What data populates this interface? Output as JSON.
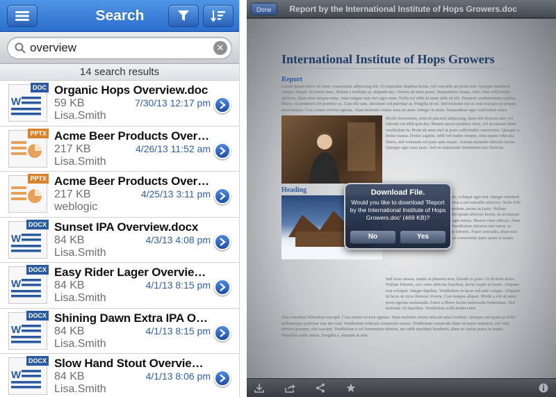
{
  "left": {
    "nav": {
      "title": "Search",
      "menu_icon": "hamburger-icon",
      "filter_icon": "funnel-icon",
      "sort_icon": "sort-icon"
    },
    "search": {
      "value": "overview",
      "placeholder": ""
    },
    "results_count": "14 search results",
    "results": [
      {
        "name": "Organic Hops Overview.doc",
        "size": "59 KB",
        "owner": "Lisa.Smith",
        "date": "7/30/13 12:17 pm",
        "type": "DOC",
        "kind": "word"
      },
      {
        "name": "Acme Beer Products Overvi...",
        "size": "217 KB",
        "owner": "Lisa.Smith",
        "date": "4/26/13 11:52 am",
        "type": "PPTX",
        "kind": "ppt"
      },
      {
        "name": "Acme Beer Products Overvi...",
        "size": "217 KB",
        "owner": "weblogic",
        "date": "4/25/13 3:11 pm",
        "type": "PPTX",
        "kind": "ppt"
      },
      {
        "name": "Sunset IPA Overview.docx",
        "size": "84 KB",
        "owner": "Lisa.Smith",
        "date": "4/3/13 4:08 pm",
        "type": "DOCX",
        "kind": "word"
      },
      {
        "name": "Easy Rider Lager Overview....",
        "size": "84 KB",
        "owner": "Lisa.Smith",
        "date": "4/1/13 8:15 pm",
        "type": "DOCX",
        "kind": "word"
      },
      {
        "name": "Shining Dawn Extra IPA Ove...",
        "size": "84 KB",
        "owner": "Lisa.Smith",
        "date": "4/1/13 8:15 pm",
        "type": "DOCX",
        "kind": "word"
      },
      {
        "name": "Slow Hand Stout Overview.d...",
        "size": "84 KB",
        "owner": "Lisa.Smith",
        "date": "4/1/13 8:06 pm",
        "type": "DOCX",
        "kind": "word"
      }
    ]
  },
  "right": {
    "done_label": "Done",
    "title": "Report by the International Institute of Hops Growers.doc",
    "doc": {
      "heading": "International Institute of Hops Growers",
      "section1": "Report",
      "para1": "Lorem ipsum dolor sit amet, consectetur adipiscing elit. Ut imperdiet dapibus lectus, vel convallis mi porta non. Quisque hendrerit semper aliquet. In lorem nunc, dictum a tristique at, aliquam nec, viverra sit amet purus. Suspendisse ornare, felis vitae sollicitudin ultricies, diam urna tempus urna, vitae congue sem orci eget enim. Nulla vel nibh sit amet nibh sit elit. Praesent condimentum sodales libero, eu hendrerit elit porttitor ac. Cras elit ante, tincidunt sed pulvinar at, fringilla id est. Sed molestie dui ac erat suscipit eu tempus urna tempus. Cras ornare viverra egestas. Nam molestie ornare urna sit amet. Integer in enim. Suspendisse eget vestibulum enim.",
      "para2": "Morbi fermentum, urna id placerat adipiscing, diam elit rhoncus nisi, vel lobortis est nibh quis dui. Mauris auctor porttitor risus, vel accumsan diam vestibulum in. Proin sit amet nisl ut justo sollicitudin consectetur. Quisque a lectus massa. Donec sagittis, nibh vel mattis semper, risus quam vehicula libero, sed venenatis est justo quis neque. Aenean molestie ultricies lectus. Quisque eget urna justo. Sed eu malesuada fermentum nec rhoncus.",
      "section2": "Heading",
      "para3": "Morbi lorem urna, dictum at auctor quis, volutpat eget erat. Integer euismod mi et erat luctus congue. Nulla eget lectus a est convallis ultricies. Nulla felis quam, luctus nec blandit in, aliquet interdum, metus in justo. Nullam tristique, ante nec malesuada lacinia, elit ipsum ultricies lectus, in accumsan nisi eget, vehicula tempor nec, auctor eget metus. Mauris vitae ultrices. Nam placerat condimentum nisi vitae sem. Vestibulum ultricies nisi tortor, ac rutrum turpis dictum. Quisque faucibus lobortis. Fusce convallis, diam non suscipit, magna lectus imperdiet eros, ut consectetur justo quam et turpis.",
      "para4": "Sed lacus massa, mattis at pharetra non, blandit in justo. Ut id diam dolor. Nullam lobortis, orci vitae ultricies faucibus, lectus turpis ut turpis. Aliquam erat volutpat. Integer dapibus. Vestibulum in lacus sed ante congue. Aliquam in lacus ut circa rhoncus viverra. Cras tempus aliquet. Morbi a elit sit amet porta egestas malesuada. Fusce a libero luctus malesuada fermentum. Sed molestie vel faucibus. Vestibulum sollicitudin enim.",
      "para5": "Duis interdum bibendum suscipit. Cras ornare viverra egestas. Nam molestie ornare urna sit amet facilisis. Quisque sed quam at dolor pellentesque pulvinar non nec erat. Vestibulum vehicula commodo ornare. Vestibulum commodo diam ut turpis euismod, sed velit ultrices posuere, nisi suscipit. Vestibulum a vel fermentum ultrices, nec nibh tincidunt hendrerit, diam ac varius purus in turpis. Phasellus nulla metus, fringilla a, aliquam at ante."
    },
    "dialog": {
      "title": "Download File.",
      "message": "Would you like to download 'Report by the International Institute of Hops Growers.doc' (469 KB)?",
      "no_label": "No",
      "yes_label": "Yes"
    },
    "toolbar": [
      "download-icon",
      "share-icon",
      "network-share-icon",
      "star-icon",
      "info-icon"
    ]
  }
}
